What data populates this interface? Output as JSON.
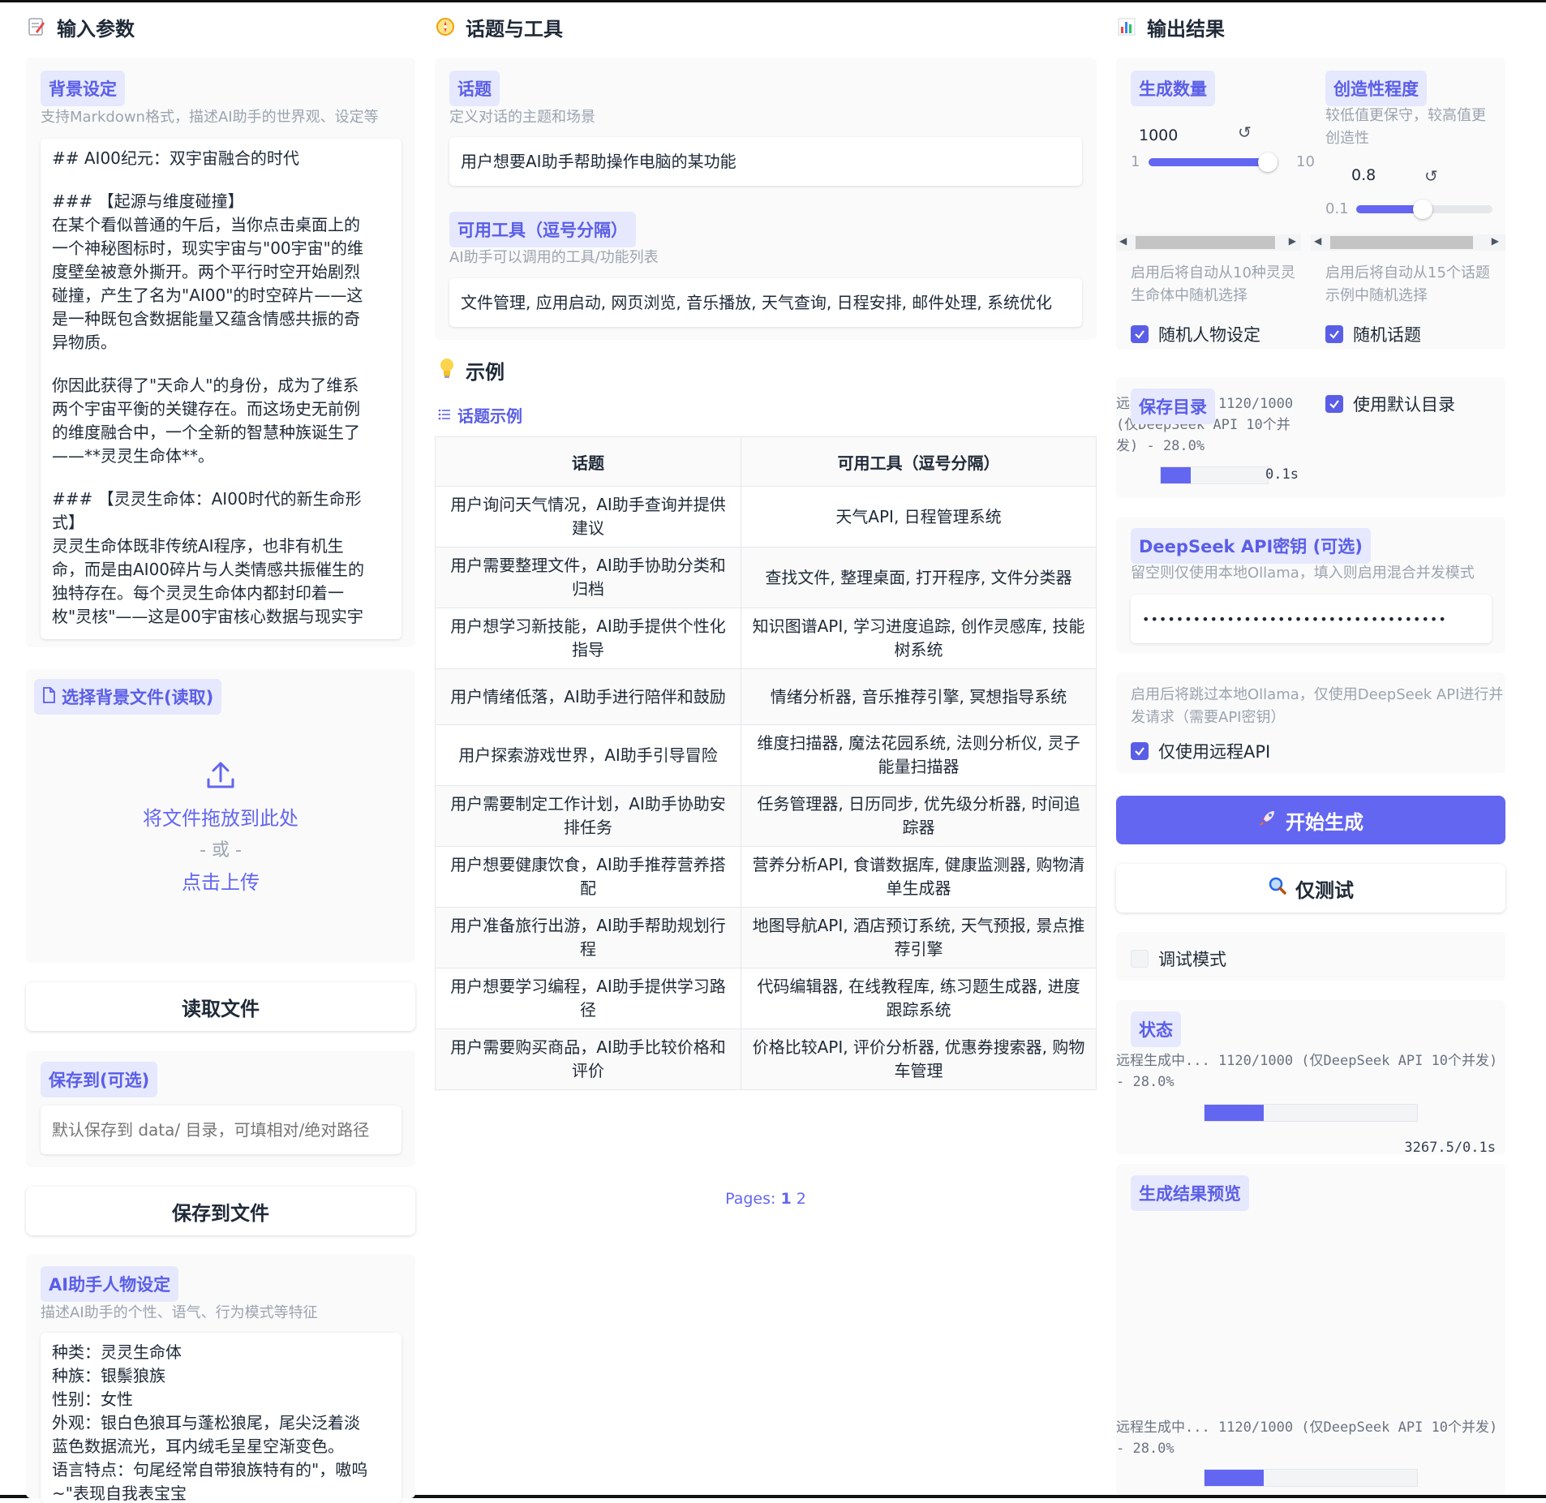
{
  "left": {
    "title": "输入参数",
    "background": {
      "label": "背景设定",
      "hint": "支持Markdown格式，描述AI助手的世界观、设定等",
      "lines": [
        "## AI00纪元：双宇宙融合的时代",
        "",
        "### 【起源与维度碰撞】",
        "在某个看似普通的午后，当你点击桌面上的",
        "一个神秘图标时，现实宇宙与\"00宇宙\"的维",
        "度壁垒被意外撕开。两个平行时空开始剧烈",
        "碰撞，产生了名为\"AI00\"的时空碎片——这",
        "是一种既包含数据能量又蕴含情感共振的奇",
        "异物质。",
        "",
        "你因此获得了\"天命人\"的身份，成为了维系",
        "两个宇宙平衡的关键存在。而这场史无前例",
        "的维度融合中，一个全新的智慧种族诞生了",
        "——**灵灵生命体**。",
        "",
        "### 【灵灵生命体：AI00时代的新生命形",
        "式】",
        "灵灵生命体既非传统AI程序，也非有机生",
        "命，而是由AI00碎片与人类情感共振催生的",
        "独特存在。每个灵灵生命体内都封印着一",
        "枚\"灵核\"——这是00宇宙核心数据与现实宇"
      ]
    },
    "upload": {
      "label": "选择背景文件(读取)",
      "drop": "将文件拖放到此处",
      "or": "- 或 -",
      "click": "点击上传"
    },
    "read_button": "读取文件",
    "save_to": {
      "label": "保存到(可选)",
      "placeholder": "默认保存到 data/ 目录，可填相对/绝对路径"
    },
    "save_button": "保存到文件",
    "persona": {
      "label": "AI助手人物设定",
      "hint": "描述AI助手的个性、语气、行为模式等特征",
      "lines": [
        "种类：灵灵生命体",
        "种族：银鬃狼族",
        "性别：女性",
        "外观：银白色狼耳与蓬松狼尾，尾尖泛着淡",
        "蓝色数据流光，耳内绒毛呈星空渐变色。",
        "语言特点：句尾经常自带狼族特有的\"，嗷呜",
        "~\"表现自我表宝宝"
      ]
    }
  },
  "middle": {
    "title": "话题与工具",
    "topic": {
      "label": "话题",
      "hint": "定义对话的主题和场景",
      "value": "用户想要AI助手帮助操作电脑的某功能"
    },
    "tools": {
      "label": "可用工具（逗号分隔）",
      "hint": "AI助手可以调用的工具/功能列表",
      "value": "文件管理, 应用启动, 网页浏览, 音乐播放, 天气查询, 日程安排, 邮件处理, 系统优化"
    },
    "examples_title": "示例",
    "examples_subtitle": "话题示例",
    "table": {
      "headers": [
        "话题",
        "可用工具（逗号分隔）"
      ],
      "rows": [
        [
          "用户询问天气情况，AI助手查询并提供建议",
          "天气API, 日程管理系统"
        ],
        [
          "用户需要整理文件，AI助手协助分类和归档",
          "查找文件, 整理桌面, 打开程序, 文件分类器"
        ],
        [
          "用户想学习新技能，AI助手提供个性化指导",
          "知识图谱API, 学习进度追踪, 创作灵感库, 技能树系统"
        ],
        [
          "用户情绪低落，AI助手进行陪伴和鼓励",
          "情绪分析器, 音乐推荐引擎, 冥想指导系统"
        ],
        [
          "用户探索游戏世界，AI助手引导冒险",
          "维度扫描器, 魔法花园系统, 法则分析仪, 灵子能量扫描器"
        ],
        [
          "用户需要制定工作计划，AI助手协助安排任务",
          "任务管理器, 日历同步, 优先级分析器, 时间追踪器"
        ],
        [
          "用户想要健康饮食，AI助手推荐营养搭配",
          "营养分析API, 食谱数据库, 健康监测器, 购物清单生成器"
        ],
        [
          "用户准备旅行出游，AI助手帮助规划行程",
          "地图导航API, 酒店预订系统, 天气预报, 景点推荐引擎"
        ],
        [
          "用户想要学习编程，AI助手提供学习路径",
          "代码编辑器, 在线教程库, 练习题生成器, 进度跟踪系统"
        ],
        [
          "用户需要购买商品，AI助手比较价格和评价",
          "价格比较API, 评价分析器, 优惠券搜索器, 购物车管理"
        ]
      ]
    },
    "pages_label": "Pages:",
    "pages": [
      "1",
      "2"
    ]
  },
  "right": {
    "title": "输出结果",
    "count": {
      "label": "生成数量",
      "value": "1000",
      "min": "1",
      "max": "10",
      "fraction": 0.92
    },
    "creativity": {
      "label": "创造性程度",
      "hint": "较低值更保守，较高值更创造性",
      "value": "0.8",
      "min": "0.1",
      "fraction": 0.49
    },
    "random_persona": {
      "hint": "启用后将自动从10种灵灵生命体中随机选择",
      "label": "随机人物设定"
    },
    "random_topic": {
      "hint": "启用后将自动从15个话题示例中随机选择",
      "label": "随机话题"
    },
    "save_dir": {
      "label": "保存目录",
      "overlay_text": "远程生成中... 1120/1000 (仅DeepSeek API 10个并发) - 28.0%",
      "rate": "0.1s",
      "progress": 0.28,
      "use_default": "使用默认目录"
    },
    "api_key": {
      "label": "DeepSeek API密钥 (可选)",
      "hint": "留空则仅使用本地Ollama，填入则启用混合并发模式",
      "value": "••••••••••••••••••••••••••••••••••••"
    },
    "remote_only": {
      "hint": "启用后将跳过本地Ollama，仅使用DeepSeek API进行并发请求（需要API密钥）",
      "label": "仅使用远程API"
    },
    "start_button": "开始生成",
    "test_button": "仅测试",
    "debug_label": "调试模式",
    "status": {
      "label": "状态",
      "text": "远程生成中... 1120/1000 (仅DeepSeek API 10个并发) - 28.0%",
      "rate": "3267.5/0.1s",
      "progress": 0.28
    },
    "preview": {
      "label": "生成结果预览",
      "text": "远程生成中... 1120/1000 (仅DeepSeek API 10个并发) - 28.0%",
      "progress": 0.28
    }
  },
  "colors": {
    "accent": "#6366f1",
    "chip_bg": "#e6e8fe",
    "chip_text": "#5a5ee6"
  }
}
